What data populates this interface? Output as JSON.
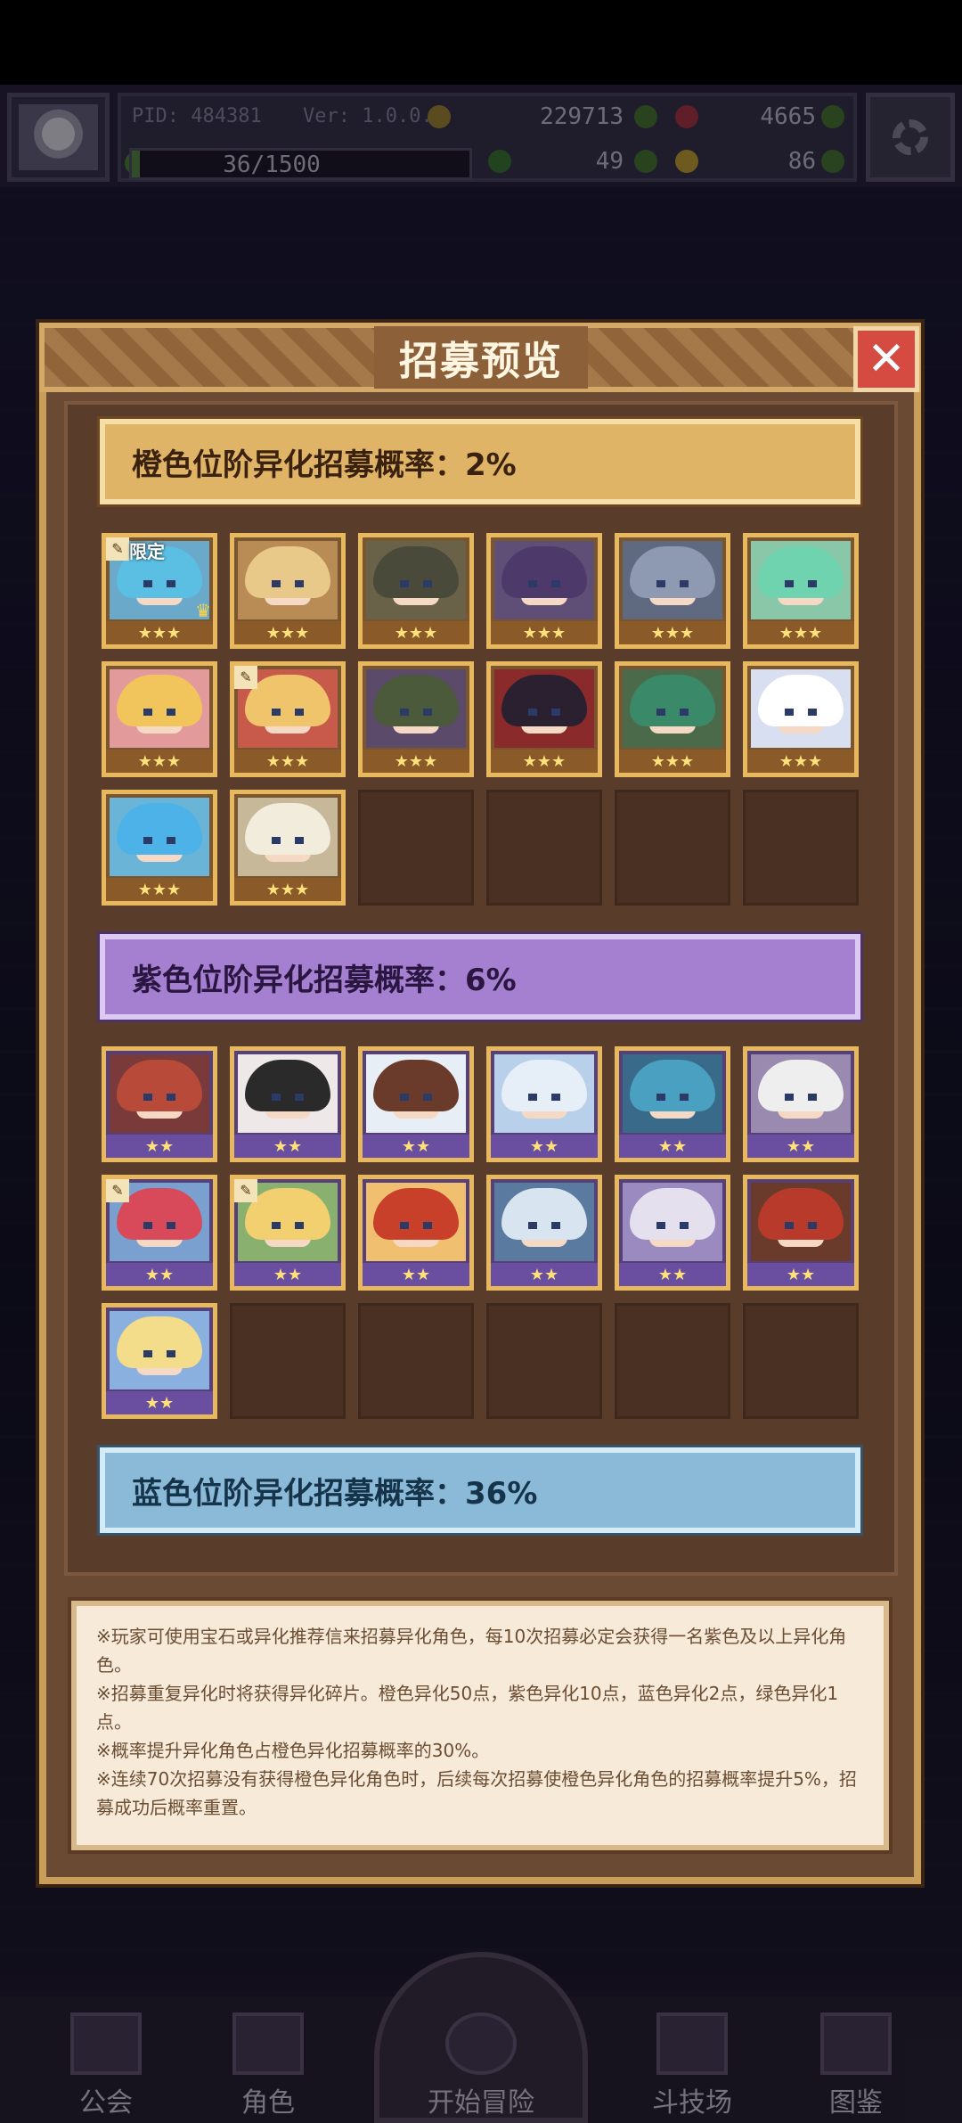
{
  "hud": {
    "pid": "PID: 484381",
    "version": "Ver: 1.0.0.9",
    "currency_coins": "229713",
    "currency_gems": "4665",
    "exp": "36/1500",
    "exp_progress": 0.024,
    "clover": "49",
    "tickets": "86"
  },
  "modal": {
    "title": "招募预览",
    "close_label": "✕"
  },
  "tiers": {
    "orange": {
      "label": "橙色位阶异化招募概率：2%",
      "limited_label": "限定",
      "stars": "★★★",
      "characters": [
        {
          "hair": "#5bbfe3",
          "bg": "#6aa9c9",
          "limited": true,
          "crown": true,
          "edit": true
        },
        {
          "hair": "#e8c98a",
          "bg": "#b98c55"
        },
        {
          "hair": "#4a4a3a",
          "bg": "#6a6248"
        },
        {
          "hair": "#4e3a6a",
          "bg": "#5f4f77"
        },
        {
          "hair": "#8d9ab2",
          "bg": "#5f6a80"
        },
        {
          "hair": "#6fd3b0",
          "bg": "#8ac7a8"
        },
        {
          "hair": "#f2c45c",
          "bg": "#e39a9a"
        },
        {
          "hair": "#f0c46a",
          "bg": "#c75a4a",
          "edit": true
        },
        {
          "hair": "#4a5a3a",
          "bg": "#5b4a6a"
        },
        {
          "hair": "#2a2030",
          "bg": "#8a2a2a"
        },
        {
          "hair": "#3a8a6a",
          "bg": "#4a6a4a"
        },
        {
          "hair": "#ffffff",
          "bg": "#d8dff0"
        },
        {
          "hair": "#4cb2e8",
          "bg": "#6ab4d8"
        },
        {
          "hair": "#f1ecdc",
          "bg": "#c8b89a"
        }
      ]
    },
    "purple": {
      "label": "紫色位阶异化招募概率：6%",
      "stars": "★★",
      "characters": [
        {
          "hair": "#b84a3a",
          "bg": "#7a3a3a"
        },
        {
          "hair": "#2a2a2a",
          "bg": "#efe8e8"
        },
        {
          "hair": "#6a3a2a",
          "bg": "#e8eef5"
        },
        {
          "hair": "#e6eef8",
          "bg": "#b9d0ea"
        },
        {
          "hair": "#4aa0c0",
          "bg": "#3a6a8a"
        },
        {
          "hair": "#eeeeee",
          "bg": "#9a8ab0"
        },
        {
          "hair": "#d84a5a",
          "bg": "#7aa0d0",
          "edit": true
        },
        {
          "hair": "#f2d070",
          "bg": "#8ab070",
          "edit": true
        },
        {
          "hair": "#c8402a",
          "bg": "#f0c070"
        },
        {
          "hair": "#d8e4f0",
          "bg": "#5a7aa0"
        },
        {
          "hair": "#e4e0ee",
          "bg": "#9a8ac0"
        },
        {
          "hair": "#b83a2a",
          "bg": "#6a3a2a"
        },
        {
          "hair": "#f3dc8a",
          "bg": "#8ab0e0"
        }
      ]
    },
    "blue": {
      "label": "蓝色位阶异化招募概率：36%"
    }
  },
  "notes": [
    "※玩家可使用宝石或异化推荐信来招募异化角色，每10次招募必定会获得一名紫色及以上异化角色。",
    "※招募重复异化时将获得异化碎片。橙色异化50点，紫色异化10点，蓝色异化2点，绿色异化1点。",
    "※概率提升异化角色占橙色异化招募概率的30%。",
    "※连续70次招募没有获得橙色异化角色时，后续每次招募使橙色异化角色的招募概率提升5%，招募成功后概率重置。"
  ],
  "nav": {
    "guild": "公会",
    "characters": "角色",
    "start": "开始冒险",
    "arena": "斗技场",
    "codex": "图鉴"
  }
}
